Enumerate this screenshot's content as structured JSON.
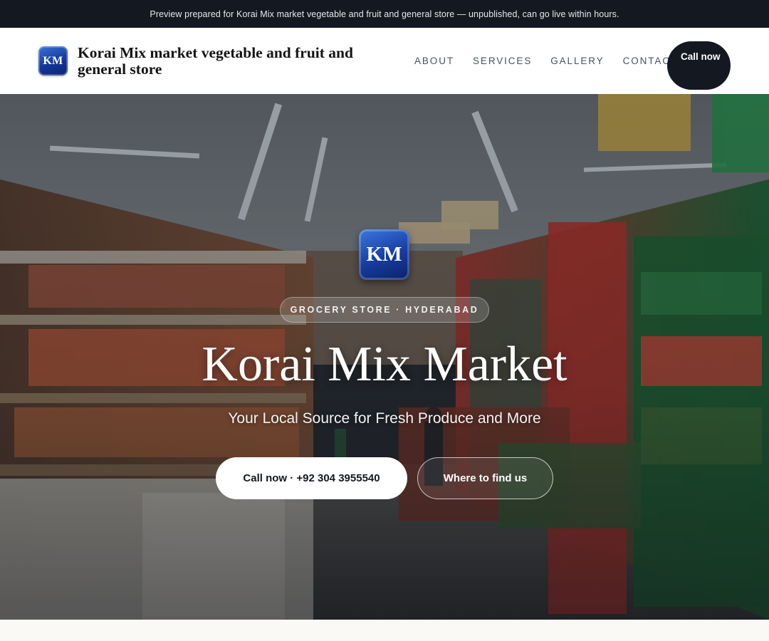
{
  "preview_banner": {
    "text": "Preview prepared for Korai Mix market vegetable and fruit and general store — unpublished, can go live within hours."
  },
  "header": {
    "logo_initials": "KM",
    "business_name": "Korai Mix market vegetable and fruit and general store",
    "nav": [
      {
        "label": "ABOUT"
      },
      {
        "label": "SERVICES"
      },
      {
        "label": "GALLERY"
      },
      {
        "label": "CONTACT"
      }
    ],
    "cta_label": "Call now"
  },
  "hero": {
    "logo_initials": "KM",
    "eyebrow": "GROCERY STORE · HYDERABAD",
    "title": "Korai Mix Market",
    "subtitle": "Your Local Source for Fresh Produce and More",
    "primary_button": "Call now · +92 304 3955540",
    "secondary_button": "Where to find us",
    "background_photo": "supermarket-aisle-photo"
  },
  "colors": {
    "dark": "#141821",
    "logo_blue": "#1a4ab3",
    "white": "#ffffff"
  }
}
